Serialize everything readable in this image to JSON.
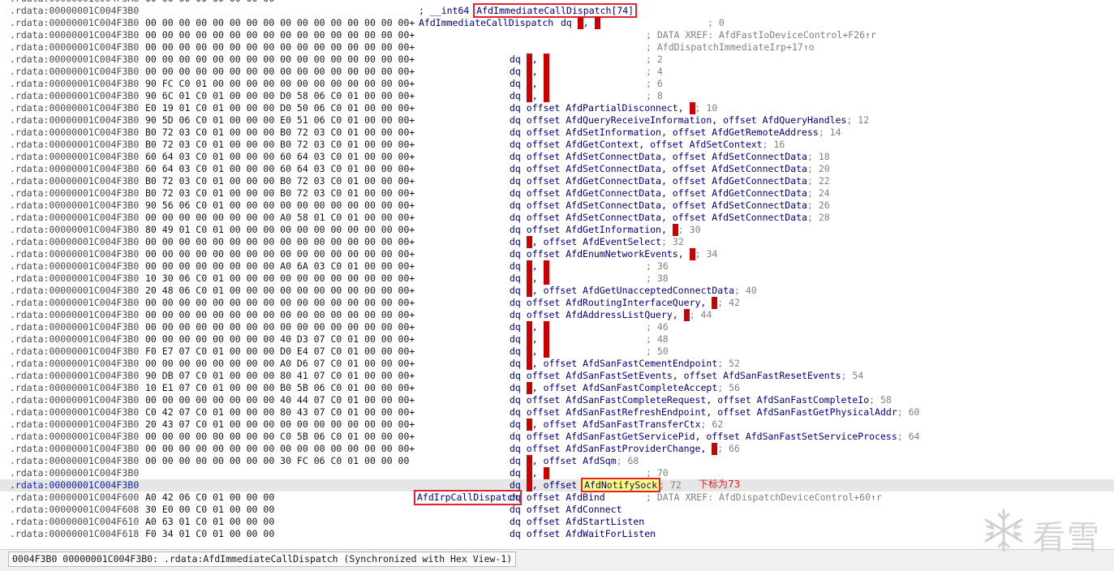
{
  "listing": [
    {
      "addr": ".rdata:00000001C004F3A8",
      "bytes": "00 00 00 00 00 00 00 00",
      "instr": "align 10h"
    },
    {
      "addr": ".rdata:00000001C004F3B0",
      "decl_prefix": "; __int64 ",
      "decl_name": "AfdImmediateCallDispatch[74]"
    },
    {
      "addr": ".rdata:00000001C004F3B0",
      "bytes": "00 00 00 00 00 00 00 00 00 00 00 00 00 00 00 00+",
      "label": "AfdImmediateCallDispatch",
      "mnem": "dq",
      "redpair": true,
      "comment": "; 0"
    },
    {
      "addr": ".rdata:00000001C004F3B0",
      "bytes": "00 00 00 00 00 00 00 00 00 00 00 00 00 00 00 00+",
      "xref": "; DATA XREF: AfdFastIoDeviceControl+F26↑r"
    },
    {
      "addr": ".rdata:00000001C004F3B0",
      "bytes": "00 00 00 00 00 00 00 00 00 00 00 00 00 00 00 00+",
      "xref": "; AfdDispatchImmediateIrp+17↑o"
    },
    {
      "addr": ".rdata:00000001C004F3B0",
      "bytes": "00 00 00 00 00 00 00 00 00 00 00 00 00 00 00 00+",
      "mnem": "dq",
      "redpair": true,
      "comment": "; 2"
    },
    {
      "addr": ".rdata:00000001C004F3B0",
      "bytes": "00 00 00 00 00 00 00 00 00 00 00 00 00 00 00 00+",
      "mnem": "dq",
      "redpair": true,
      "comment": "; 4"
    },
    {
      "addr": ".rdata:00000001C004F3B0",
      "bytes": "90 FC C0 01 00 00 00 00 00 00 00 00 00 00 00 00+",
      "mnem": "dq",
      "redpair": true,
      "comment": "; 6"
    },
    {
      "addr": ".rdata:00000001C004F3B0",
      "bytes": "90 6C 01 C0 01 00 00 00 D0 58 06 C0 01 00 00 00+",
      "mnem": "dq",
      "redpair": true,
      "comment": "; 8"
    },
    {
      "addr": ".rdata:00000001C004F3B0",
      "bytes": "E0 19 01 C0 01 00 00 00 D0 50 06 C0 01 00 00 00+",
      "mnem": "dq",
      "ops": [
        "offset AfdPartialDisconnect, ",
        "R",
        "; 10"
      ]
    },
    {
      "addr": ".rdata:00000001C004F3B0",
      "bytes": "90 5D 06 C0 01 00 00 00 E0 51 06 C0 01 00 00 00+",
      "mnem": "dq",
      "ops": [
        "offset AfdQueryReceiveInformation, offset AfdQueryHandles",
        "; 12"
      ]
    },
    {
      "addr": ".rdata:00000001C004F3B0",
      "bytes": "B0 72 03 C0 01 00 00 00 B0 72 03 C0 01 00 00 00+",
      "mnem": "dq",
      "ops": [
        "offset AfdSetInformation, offset AfdGetRemoteAddress",
        "; 14"
      ]
    },
    {
      "addr": ".rdata:00000001C004F3B0",
      "bytes": "B0 72 03 C0 01 00 00 00 B0 72 03 C0 01 00 00 00+",
      "mnem": "dq",
      "ops": [
        "offset AfdGetContext, offset AfdSetContext",
        "; 16"
      ]
    },
    {
      "addr": ".rdata:00000001C004F3B0",
      "bytes": "60 64 03 C0 01 00 00 00 60 64 03 C0 01 00 00 00+",
      "mnem": "dq",
      "ops": [
        "offset AfdSetConnectData, offset AfdSetConnectData",
        "; 18"
      ]
    },
    {
      "addr": ".rdata:00000001C004F3B0",
      "bytes": "60 64 03 C0 01 00 00 00 60 64 03 C0 01 00 00 00+",
      "mnem": "dq",
      "ops": [
        "offset AfdSetConnectData, offset AfdSetConnectData",
        "; 20"
      ]
    },
    {
      "addr": ".rdata:00000001C004F3B0",
      "bytes": "B0 72 03 C0 01 00 00 00 B0 72 03 C0 01 00 00 00+",
      "mnem": "dq",
      "ops": [
        "offset AfdGetConnectData, offset AfdGetConnectData",
        "; 22"
      ]
    },
    {
      "addr": ".rdata:00000001C004F3B0",
      "bytes": "B0 72 03 C0 01 00 00 00 B0 72 03 C0 01 00 00 00+",
      "mnem": "dq",
      "ops": [
        "offset AfdGetConnectData, offset AfdGetConnectData",
        "; 24"
      ]
    },
    {
      "addr": ".rdata:00000001C004F3B0",
      "bytes": "90 56 06 C0 01 00 00 00 00 00 00 00 00 00 00 00+",
      "mnem": "dq",
      "ops": [
        "offset AfdSetConnectData, offset AfdSetConnectData",
        "; 26"
      ]
    },
    {
      "addr": ".rdata:00000001C004F3B0",
      "bytes": "00 00 00 00 00 00 00 00 A0 58 01 C0 01 00 00 00+",
      "mnem": "dq",
      "ops": [
        "offset AfdSetConnectData, offset AfdSetConnectData",
        "; 28"
      ]
    },
    {
      "addr": ".rdata:00000001C004F3B0",
      "bytes": "80 49 01 C0 01 00 00 00 00 00 00 00 00 00 00 00+",
      "mnem": "dq",
      "ops": [
        "offset AfdGetInformation, ",
        "R",
        "; 30"
      ]
    },
    {
      "addr": ".rdata:00000001C004F3B0",
      "bytes": "00 00 00 00 00 00 00 00 00 00 00 00 00 00 00 00+",
      "mnem": "dq",
      "ops": [
        "R",
        ", offset AfdEventSelect",
        "; 32"
      ]
    },
    {
      "addr": ".rdata:00000001C004F3B0",
      "bytes": "00 00 00 00 00 00 00 00 00 00 00 00 00 00 00 00+",
      "mnem": "dq",
      "ops": [
        "offset AfdEnumNetworkEvents, ",
        "R",
        "; 34"
      ]
    },
    {
      "addr": ".rdata:00000001C004F3B0",
      "bytes": "00 00 00 00 00 00 00 00 A0 6A 03 C0 01 00 00 00+",
      "mnem": "dq",
      "redpair": true,
      "comment": "; 36"
    },
    {
      "addr": ".rdata:00000001C004F3B0",
      "bytes": "10 30 06 C0 01 00 00 00 00 00 00 00 00 00 00 00+",
      "mnem": "dq",
      "redpair": true,
      "comment": "; 38"
    },
    {
      "addr": ".rdata:00000001C004F3B0",
      "bytes": "20 48 06 C0 01 00 00 00 00 00 00 00 00 00 00 00+",
      "mnem": "dq",
      "ops": [
        "R",
        ", offset AfdGetUnacceptedConnectData",
        "; 40"
      ]
    },
    {
      "addr": ".rdata:00000001C004F3B0",
      "bytes": "00 00 00 00 00 00 00 00 00 00 00 00 00 00 00 00+",
      "mnem": "dq",
      "ops": [
        "offset AfdRoutingInterfaceQuery, ",
        "R",
        "; 42"
      ]
    },
    {
      "addr": ".rdata:00000001C004F3B0",
      "bytes": "00 00 00 00 00 00 00 00 00 00 00 00 00 00 00 00+",
      "mnem": "dq",
      "ops": [
        "offset AfdAddressListQuery, ",
        "R",
        "; 44"
      ]
    },
    {
      "addr": ".rdata:00000001C004F3B0",
      "bytes": "00 00 00 00 00 00 00 00 00 00 00 00 00 00 00 00+",
      "mnem": "dq",
      "redpair": true,
      "comment": "; 46"
    },
    {
      "addr": ".rdata:00000001C004F3B0",
      "bytes": "00 00 00 00 00 00 00 00 40 D3 07 C0 01 00 00 00+",
      "mnem": "dq",
      "redpair": true,
      "comment": "; 48"
    },
    {
      "addr": ".rdata:00000001C004F3B0",
      "bytes": "F0 E7 07 C0 01 00 00 00 D0 E4 07 C0 01 00 00 00+",
      "mnem": "dq",
      "redpair": true,
      "comment": "; 50"
    },
    {
      "addr": ".rdata:00000001C004F3B0",
      "bytes": "00 00 00 00 00 00 00 00 A0 D6 07 C0 01 00 00 00+",
      "mnem": "dq",
      "ops": [
        "R",
        ", offset AfdSanFastCementEndpoint",
        "; 52"
      ]
    },
    {
      "addr": ".rdata:00000001C004F3B0",
      "bytes": "90 DB 07 C0 01 00 00 00 80 41 07 C0 01 00 00 00+",
      "mnem": "dq",
      "ops": [
        "offset AfdSanFastSetEvents, offset AfdSanFastResetEvents",
        "; 54"
      ]
    },
    {
      "addr": ".rdata:00000001C004F3B0",
      "bytes": "10 E1 07 C0 01 00 00 00 B0 5B 06 C0 01 00 00 00+",
      "mnem": "dq",
      "ops": [
        "R",
        ", offset AfdSanFastCompleteAccept",
        "; 56"
      ]
    },
    {
      "addr": ".rdata:00000001C004F3B0",
      "bytes": "00 00 00 00 00 00 00 00 40 44 07 C0 01 00 00 00+",
      "mnem": "dq",
      "ops": [
        "offset AfdSanFastCompleteRequest, offset AfdSanFastCompleteIo",
        "; 58"
      ]
    },
    {
      "addr": ".rdata:00000001C004F3B0",
      "bytes": "C0 42 07 C0 01 00 00 00 80 43 07 C0 01 00 00 00+",
      "mnem": "dq",
      "ops": [
        "offset AfdSanFastRefreshEndpoint, offset AfdSanFastGetPhysicalAddr",
        "; 60"
      ]
    },
    {
      "addr": ".rdata:00000001C004F3B0",
      "bytes": "20 43 07 C0 01 00 00 00 00 00 00 00 00 00 00 00+",
      "mnem": "dq",
      "ops": [
        "R",
        ", offset AfdSanFastTransferCtx",
        "; 62"
      ]
    },
    {
      "addr": ".rdata:00000001C004F3B0",
      "bytes": "00 00 00 00 00 00 00 00 C0 5B 06 C0 01 00 00 00+",
      "mnem": "dq",
      "ops": [
        "offset AfdSanFastGetServicePid, offset AfdSanFastSetServiceProcess",
        "; 64"
      ]
    },
    {
      "addr": ".rdata:00000001C004F3B0",
      "bytes": "00 00 00 00 00 00 00 00 00 00 00 00 00 00 00 00+",
      "mnem": "dq",
      "ops": [
        "offset AfdSanFastProviderChange, ",
        "R",
        "; 66"
      ]
    },
    {
      "addr": ".rdata:00000001C004F3B0",
      "bytes": "00 00 00 00 00 00 00 00 30 FC 06 C0 01 00 00 00",
      "mnem": "dq",
      "ops": [
        "R",
        ", offset AfdSqm",
        "; 68"
      ]
    },
    {
      "addr": ".rdata:00000001C004F3B0",
      "bytes": "",
      "mnem": "dq",
      "redpair": true,
      "comment": "; 70"
    },
    {
      "addr": ".rdata:00000001C004F3B0",
      "bytes": "",
      "mnem": "dq",
      "current": true,
      "ops": [
        "R",
        ", offset ",
        "NOTIFY",
        "; 72"
      ]
    },
    {
      "addr": ".rdata:00000001C004F600",
      "bytes": "A0 42 06 C0 01 00 00 00",
      "label2": "AfdIrpCallDispatch",
      "mnem": "dq",
      "ops": [
        "offset AfdBind"
      ],
      "xref": "; DATA XREF: AfdDispatchDeviceControl+60↑r"
    },
    {
      "addr": ".rdata:00000001C004F608",
      "bytes": "30 E0 00 C0 01 00 00 00",
      "mnem": "dq",
      "ops": [
        "offset AfdConnect"
      ]
    },
    {
      "addr": ".rdata:00000001C004F610",
      "bytes": "A0 63 01 C0 01 00 00 00",
      "mnem": "dq",
      "ops": [
        "offset AfdStartListen"
      ]
    },
    {
      "addr": ".rdata:00000001C004F618",
      "bytes": "F0 34 01 C0 01 00 00 00",
      "mnem": "dq",
      "ops": [
        "offset AfdWaitForListen"
      ]
    }
  ],
  "notify_sock": "AfdNotifySock",
  "annotation": "下标为73",
  "status": {
    "text": "0004F3B0 00000001C004F3B0: .rdata:AfdImmediateCallDispatch (Synchronized with Hex View-1)"
  },
  "watermark": {
    "text": "看雪",
    "icon": "snowflake-icon"
  },
  "colors": {
    "highlight_box": "#e3232f",
    "yellow_highlight": "#ffff7a",
    "red_operand": "#cc0000",
    "code_blue": "#000080",
    "comment_gray": "#808080"
  }
}
